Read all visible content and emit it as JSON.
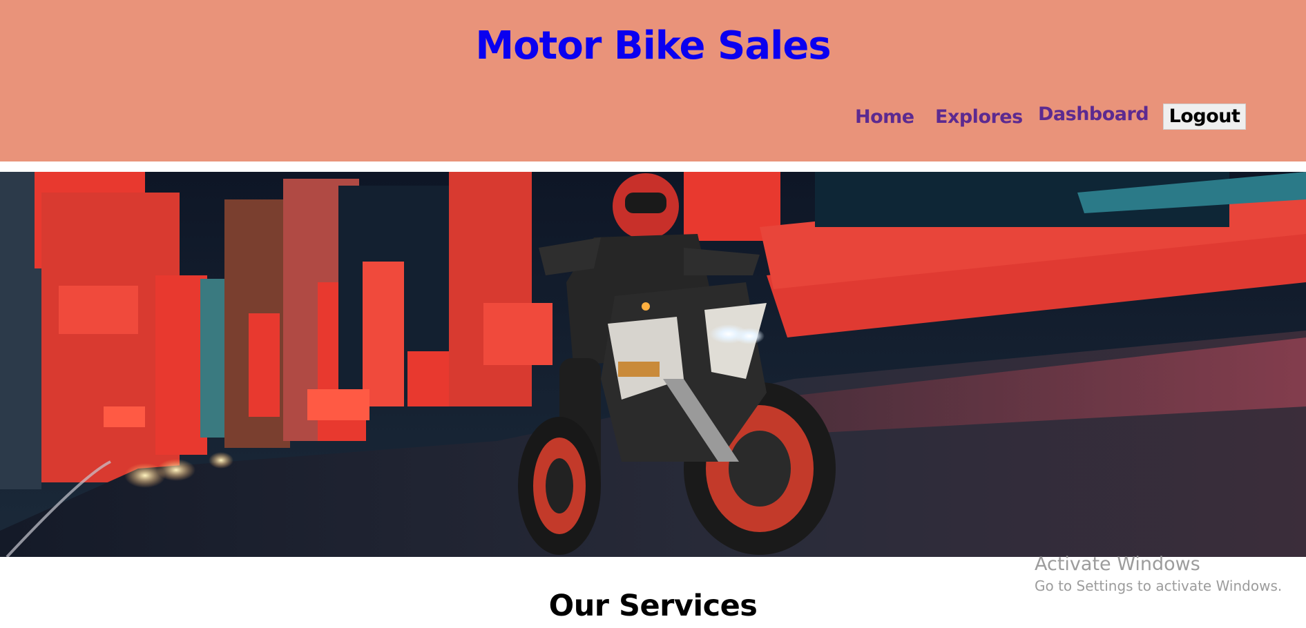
{
  "header": {
    "site_title": "Motor Bike Sales",
    "bg_color": "#e9937a",
    "title_color": "#0a00f0",
    "nav": {
      "home": "Home",
      "explores": "Explores",
      "dashboard": "Dashboard",
      "logout": "Logout"
    }
  },
  "hero": {
    "image_description_icon": "motorbike-banner-image"
  },
  "main": {
    "section_title": "Our Services"
  },
  "os_overlay": {
    "title": "Activate Windows",
    "subtitle": "Go to Settings to activate Windows."
  }
}
